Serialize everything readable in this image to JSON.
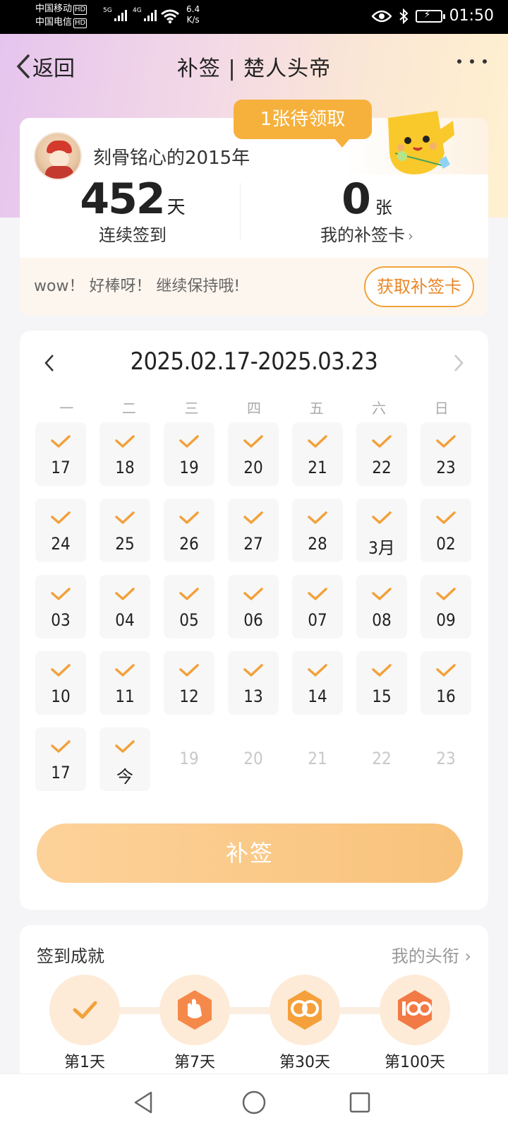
{
  "status_bar": {
    "carrier1": "中国移动",
    "carrier2": "中国电信",
    "hd": "HD",
    "sig1_label": "5G",
    "sig2_label": "4G",
    "net_speed_value": "6.4",
    "net_speed_unit": "K/s",
    "time": "01:50"
  },
  "header": {
    "back_label": "返回",
    "title": "补签 | 楚人头帝"
  },
  "summary": {
    "username": "刻骨铭心的2015年",
    "tooltip": "1张待领取",
    "streak_value": "452",
    "streak_unit": "天",
    "streak_label": "连续签到",
    "cards_value": "0",
    "cards_unit": "张",
    "cards_label": "我的补签卡",
    "encourage": "wow！ 好棒呀！ 继续保持哦!",
    "get_card_button": "获取补签卡"
  },
  "calendar": {
    "range": "2025.02.17-2025.03.23",
    "weekdays": [
      "一",
      "二",
      "三",
      "四",
      "五",
      "六",
      "日"
    ],
    "days": [
      {
        "label": "17",
        "checked": true
      },
      {
        "label": "18",
        "checked": true
      },
      {
        "label": "19",
        "checked": true
      },
      {
        "label": "20",
        "checked": true
      },
      {
        "label": "21",
        "checked": true
      },
      {
        "label": "22",
        "checked": true
      },
      {
        "label": "23",
        "checked": true
      },
      {
        "label": "24",
        "checked": true
      },
      {
        "label": "25",
        "checked": true
      },
      {
        "label": "26",
        "checked": true
      },
      {
        "label": "27",
        "checked": true
      },
      {
        "label": "28",
        "checked": true
      },
      {
        "label": "3月",
        "checked": true
      },
      {
        "label": "02",
        "checked": true
      },
      {
        "label": "03",
        "checked": true
      },
      {
        "label": "04",
        "checked": true
      },
      {
        "label": "05",
        "checked": true
      },
      {
        "label": "06",
        "checked": true
      },
      {
        "label": "07",
        "checked": true
      },
      {
        "label": "08",
        "checked": true
      },
      {
        "label": "09",
        "checked": true
      },
      {
        "label": "10",
        "checked": true
      },
      {
        "label": "11",
        "checked": true
      },
      {
        "label": "12",
        "checked": true
      },
      {
        "label": "13",
        "checked": true
      },
      {
        "label": "14",
        "checked": true
      },
      {
        "label": "15",
        "checked": true
      },
      {
        "label": "16",
        "checked": true
      },
      {
        "label": "17",
        "checked": true
      },
      {
        "label": "今",
        "checked": true
      },
      {
        "label": "19",
        "checked": false
      },
      {
        "label": "20",
        "checked": false
      },
      {
        "label": "21",
        "checked": false
      },
      {
        "label": "22",
        "checked": false
      },
      {
        "label": "23",
        "checked": false
      }
    ],
    "resign_button": "补签"
  },
  "achievements": {
    "title": "签到成就",
    "link": "我的头衔",
    "badges": [
      {
        "label": "第1天",
        "icon": "check-icon"
      },
      {
        "label": "第7天",
        "icon": "hand-badge-icon"
      },
      {
        "label": "第30天",
        "icon": "30-days-badge-icon"
      },
      {
        "label": "第100天",
        "icon": "100-days-badge-icon"
      }
    ]
  },
  "colors": {
    "accent": "#f0a33a",
    "check": "#f2a13a",
    "tooltip": "#f6b13c",
    "resign_button": "#f8c27a"
  }
}
